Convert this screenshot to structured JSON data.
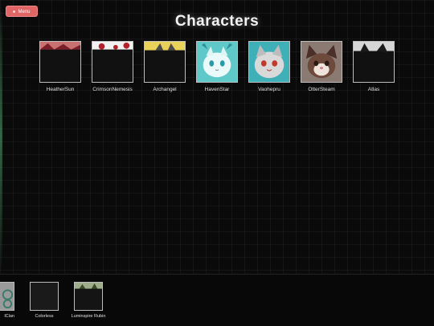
{
  "menu": {
    "label": "Menu"
  },
  "page": {
    "title": "Characters"
  },
  "characters": [
    {
      "name": "HeatherSun"
    },
    {
      "name": "CrimsonNemesis"
    },
    {
      "name": "Archangel"
    },
    {
      "name": "HavenStar"
    },
    {
      "name": "Vaohepru"
    },
    {
      "name": "OtterSteam"
    },
    {
      "name": "Atlas"
    }
  ],
  "bottom_bar": [
    {
      "name": "lClan"
    },
    {
      "name": "Colorless"
    },
    {
      "name": "Luminspire Rubin"
    }
  ],
  "colors": {
    "menu_button": "#e06666",
    "background": "#0a0a0a",
    "card_border": "#bdbdbd"
  }
}
